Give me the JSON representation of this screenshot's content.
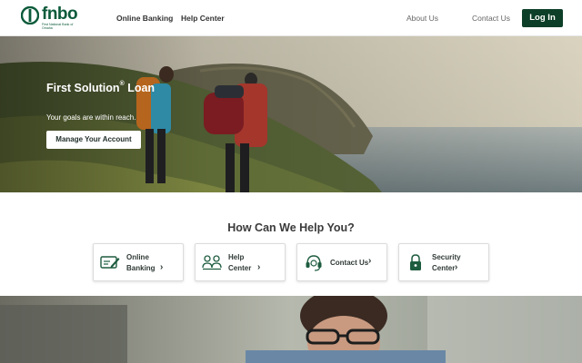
{
  "brand": {
    "name": "fnbo",
    "subtitle": "First National Bank of Omaha",
    "color": "#0b5a3a"
  },
  "nav": {
    "online_banking": "Online Banking",
    "help_center": "Help Center",
    "about_us": "About Us",
    "contact_us": "Contact Us",
    "login": "Log In"
  },
  "hero": {
    "title": "First Solution",
    "title_mark": "®",
    "title_suffix": " Loan",
    "subtitle": "Your goals are within reach.",
    "button": "Manage Your Account"
  },
  "help": {
    "heading": "How Can We Help You?",
    "cards": [
      {
        "line1": "Online",
        "line2": "Banking",
        "icon": "check-card-icon"
      },
      {
        "line1": "Help",
        "line2": "Center",
        "icon": "people-icon"
      },
      {
        "line1": "Contact Us",
        "line2": "",
        "icon": "headset-icon"
      },
      {
        "line1": "Security",
        "line2": "Center",
        "icon": "lock-icon"
      }
    ]
  },
  "colors": {
    "primary_dark": "#0d3f28",
    "icon_green": "#1e5c3f"
  }
}
